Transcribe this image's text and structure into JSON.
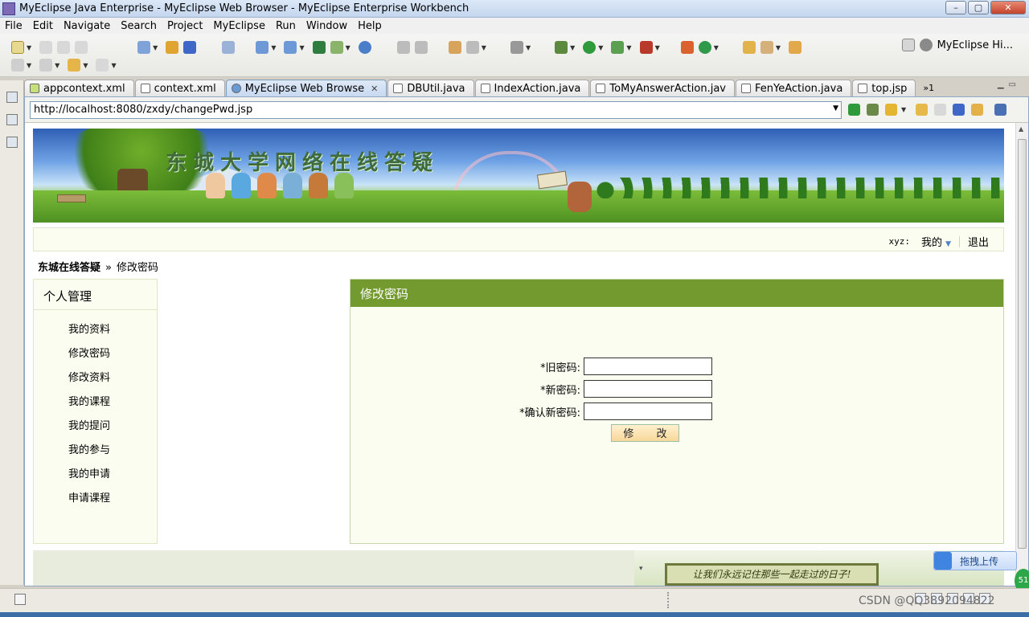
{
  "window": {
    "title": "MyEclipse Java Enterprise - MyEclipse Web Browser - MyEclipse Enterprise Workbench"
  },
  "menu": [
    "File",
    "Edit",
    "Navigate",
    "Search",
    "Project",
    "MyEclipse",
    "Run",
    "Window",
    "Help"
  ],
  "perspective": {
    "label": "MyEclipse Hi..."
  },
  "tabs": [
    {
      "label": "appcontext.xml"
    },
    {
      "label": "context.xml"
    },
    {
      "label": "MyEclipse Web Browse"
    },
    {
      "label": "DBUtil.java"
    },
    {
      "label": "IndexAction.java"
    },
    {
      "label": "ToMyAnswerAction.jav"
    },
    {
      "label": "FenYeAction.java"
    },
    {
      "label": "top.jsp"
    }
  ],
  "tab_overflow": "»1",
  "browser": {
    "url": "http://localhost:8080/zxdy/changePwd.jsp"
  },
  "site": {
    "banner_title": "东城大学网络在线答疑",
    "user": {
      "name": "xyz:",
      "my": "我的",
      "logout": "退出"
    },
    "breadcrumb": {
      "home": "东城在线答疑",
      "separator": "»",
      "current": "修改密码"
    },
    "sidebar": {
      "title": "个人管理",
      "items": [
        "我的资料",
        "修改密码",
        "修改资料",
        "我的课程",
        "我的提问",
        "我的参与",
        "我的申请",
        "申请课程"
      ]
    },
    "panel": {
      "title": "修改密码",
      "fields": [
        {
          "label": "*旧密码:",
          "value": ""
        },
        {
          "label": "*新密码:",
          "value": ""
        },
        {
          "label": "*确认新密码:",
          "value": ""
        }
      ],
      "submit": "修 改"
    },
    "footer_slogan": "让我们永远记住那些一起走过的日子!"
  },
  "overlay": {
    "upload_label": "拖拽上传",
    "badge": "51"
  },
  "watermark": "CSDN @QQ3892094822",
  "colors": {
    "panel_header": "#739a2f",
    "panel_bg": "#fbfdf0"
  }
}
